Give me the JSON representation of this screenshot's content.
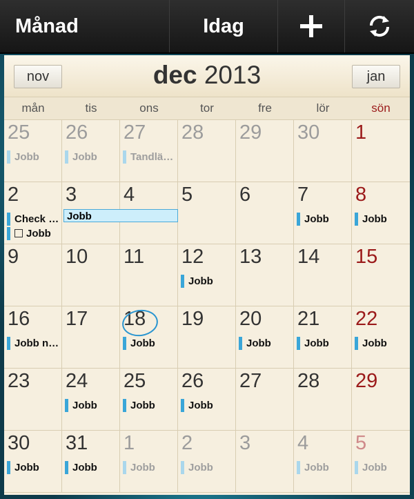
{
  "toolbar": {
    "month_label": "Månad",
    "today_label": "Idag",
    "add_icon": "plus-icon",
    "sync_icon": "refresh-icon"
  },
  "header": {
    "prev_month": "nov",
    "next_month": "jan",
    "month": "dec",
    "year": "2013"
  },
  "weekdays": [
    "mån",
    "tis",
    "ons",
    "tor",
    "fre",
    "lör",
    "sön"
  ],
  "colors": {
    "event_bar": "#3aa6d8",
    "sunday": "#9b1a1a",
    "today_ring": "#2a95d0"
  },
  "today": "18",
  "weeks": [
    [
      {
        "day": "25",
        "other": true,
        "events": [
          "Jobb"
        ]
      },
      {
        "day": "26",
        "other": true,
        "events": [
          "Jobb"
        ]
      },
      {
        "day": "27",
        "other": true,
        "events": [
          "Tandläk…"
        ]
      },
      {
        "day": "28",
        "other": true,
        "events": []
      },
      {
        "day": "29",
        "other": true,
        "events": []
      },
      {
        "day": "30",
        "other": true,
        "events": []
      },
      {
        "day": "1",
        "other": false,
        "events": []
      }
    ],
    [
      {
        "day": "2",
        "other": false,
        "events": [
          "Check u…",
          "Jobb"
        ]
      },
      {
        "day": "3",
        "other": false,
        "events": []
      },
      {
        "day": "4",
        "other": false,
        "events": []
      },
      {
        "day": "5",
        "other": false,
        "events": []
      },
      {
        "day": "6",
        "other": false,
        "events": []
      },
      {
        "day": "7",
        "other": false,
        "events": [
          "Jobb"
        ]
      },
      {
        "day": "8",
        "other": false,
        "events": [
          "Jobb"
        ]
      }
    ],
    [
      {
        "day": "9",
        "other": false,
        "events": []
      },
      {
        "day": "10",
        "other": false,
        "events": []
      },
      {
        "day": "11",
        "other": false,
        "events": []
      },
      {
        "day": "12",
        "other": false,
        "events": [
          "Jobb"
        ]
      },
      {
        "day": "13",
        "other": false,
        "events": []
      },
      {
        "day": "14",
        "other": false,
        "events": []
      },
      {
        "day": "15",
        "other": false,
        "events": []
      }
    ],
    [
      {
        "day": "16",
        "other": false,
        "events": [
          "Jobb nå…"
        ]
      },
      {
        "day": "17",
        "other": false,
        "events": []
      },
      {
        "day": "18",
        "other": false,
        "events": [
          "Jobb"
        ]
      },
      {
        "day": "19",
        "other": false,
        "events": []
      },
      {
        "day": "20",
        "other": false,
        "events": [
          "Jobb"
        ]
      },
      {
        "day": "21",
        "other": false,
        "events": [
          "Jobb"
        ]
      },
      {
        "day": "22",
        "other": false,
        "events": [
          "Jobb"
        ]
      }
    ],
    [
      {
        "day": "23",
        "other": false,
        "events": []
      },
      {
        "day": "24",
        "other": false,
        "events": [
          "Jobb"
        ]
      },
      {
        "day": "25",
        "other": false,
        "events": [
          "Jobb"
        ]
      },
      {
        "day": "26",
        "other": false,
        "events": [
          "Jobb"
        ]
      },
      {
        "day": "27",
        "other": false,
        "events": []
      },
      {
        "day": "28",
        "other": false,
        "events": []
      },
      {
        "day": "29",
        "other": false,
        "events": []
      }
    ],
    [
      {
        "day": "30",
        "other": false,
        "events": [
          "Jobb"
        ]
      },
      {
        "day": "31",
        "other": false,
        "events": [
          "Jobb"
        ]
      },
      {
        "day": "1",
        "other": true,
        "events": [
          "Jobb"
        ]
      },
      {
        "day": "2",
        "other": true,
        "events": [
          "Jobb"
        ]
      },
      {
        "day": "3",
        "other": true,
        "events": []
      },
      {
        "day": "4",
        "other": true,
        "events": [
          "Jobb"
        ]
      },
      {
        "day": "5",
        "other": true,
        "events": [
          "Jobb"
        ]
      }
    ]
  ],
  "multi_day_event": "Jobb"
}
